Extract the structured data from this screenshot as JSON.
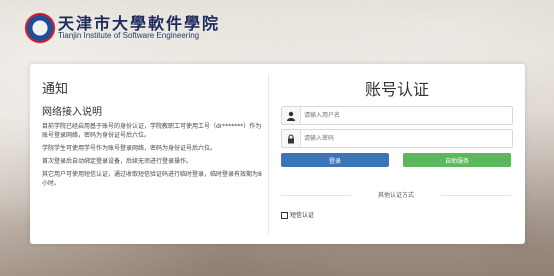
{
  "logo": {
    "title_cn": "天津市大學軟件學院",
    "title_en": "Tianjin Institute of Software Engineering"
  },
  "left": {
    "title": "通知",
    "subtitle": "网络接入说明",
    "paragraphs": [
      "目前学院已经启用基于账号的身份认证，学院教职工可使用工号（dr*******）作为账号登录网络，密码为身份证号后六位。",
      "学院学生可使用学号作为账号登录网络，密码为身份证号后六位。",
      "首次登录后自动绑定登录设备，后续无须进行登录操作。",
      "其它用户可使用短信认证，通过收取短信验证码进行临时登录，临时登录有效期为8小时。"
    ]
  },
  "right": {
    "title": "账号认证",
    "username_placeholder": "请输入用户名",
    "password_placeholder": "请输入密码",
    "login_label": "登录",
    "selfservice_label": "自助服务",
    "other_methods_label": "其他认证方式",
    "sms_label": "短信认证"
  },
  "colors": {
    "login_button": "#3c75b7",
    "selfservice_button": "#5cb85c"
  }
}
